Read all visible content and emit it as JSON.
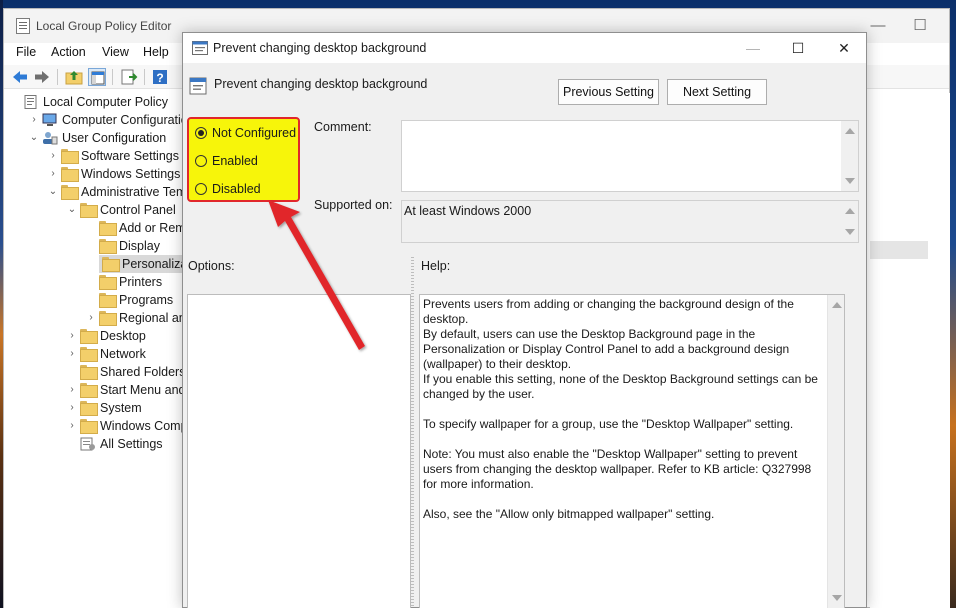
{
  "main_window": {
    "title": "Local Group Policy Editor",
    "menu": [
      "File",
      "Action",
      "View",
      "Help"
    ],
    "tree": [
      {
        "label": "Local Computer Policy",
        "depth": 0,
        "icon": "computer-policy-icon",
        "expander": ""
      },
      {
        "label": "Computer Configuration",
        "depth": 1,
        "icon": "computer-icon",
        "expander": "›"
      },
      {
        "label": "User Configuration",
        "depth": 1,
        "icon": "user-icon",
        "expander": "⌄"
      },
      {
        "label": "Software Settings",
        "depth": 2,
        "icon": "folder-icon",
        "expander": "›"
      },
      {
        "label": "Windows Settings",
        "depth": 2,
        "icon": "folder-icon",
        "expander": "›"
      },
      {
        "label": "Administrative Templ",
        "depth": 2,
        "icon": "folder-icon",
        "expander": "⌄"
      },
      {
        "label": "Control Panel",
        "depth": 3,
        "icon": "folder-open-icon",
        "expander": "⌄"
      },
      {
        "label": "Add or Remov",
        "depth": 4,
        "icon": "folder-icon",
        "expander": ""
      },
      {
        "label": "Display",
        "depth": 4,
        "icon": "folder-icon",
        "expander": ""
      },
      {
        "label": "Personalization",
        "depth": 4,
        "icon": "folder-icon",
        "expander": "",
        "selected": true
      },
      {
        "label": "Printers",
        "depth": 4,
        "icon": "folder-icon",
        "expander": ""
      },
      {
        "label": "Programs",
        "depth": 4,
        "icon": "folder-icon",
        "expander": ""
      },
      {
        "label": "Regional and L",
        "depth": 4,
        "icon": "folder-icon",
        "expander": "›"
      },
      {
        "label": "Desktop",
        "depth": 3,
        "icon": "folder-icon",
        "expander": "›"
      },
      {
        "label": "Network",
        "depth": 3,
        "icon": "folder-icon",
        "expander": "›"
      },
      {
        "label": "Shared Folders",
        "depth": 3,
        "icon": "folder-icon",
        "expander": ""
      },
      {
        "label": "Start Menu and Ta",
        "depth": 3,
        "icon": "folder-icon",
        "expander": "›"
      },
      {
        "label": "System",
        "depth": 3,
        "icon": "folder-icon",
        "expander": "›"
      },
      {
        "label": "Windows Compor",
        "depth": 3,
        "icon": "folder-icon",
        "expander": "›"
      },
      {
        "label": "All Settings",
        "depth": 3,
        "icon": "all-settings-icon",
        "expander": ""
      }
    ]
  },
  "dialog": {
    "title": "Prevent changing desktop background",
    "heading": "Prevent changing desktop background",
    "previous_label": "Previous Setting",
    "next_label": "Next Setting",
    "radios": [
      {
        "label": "Not Configured",
        "checked": true
      },
      {
        "label": "Enabled",
        "checked": false
      },
      {
        "label": "Disabled",
        "checked": false
      }
    ],
    "comment_label": "Comment:",
    "comment_value": "",
    "supported_label": "Supported on:",
    "supported_value": "At least Windows 2000",
    "options_label": "Options:",
    "help_label": "Help:",
    "help_paragraphs": [
      "Prevents users from adding or changing the background design of the desktop.",
      "By default, users can use the Desktop Background page in the Personalization or Display Control Panel to add a background design (wallpaper) to their desktop.",
      "If you enable this setting, none of the Desktop Background settings can be changed by the user.",
      "To specify wallpaper for a group, use the \"Desktop Wallpaper\" setting.",
      "Note: You must also enable the \"Desktop Wallpaper\" setting to prevent users from changing the desktop wallpaper. Refer to KB article: Q327998 for more information.",
      "Also, see the \"Allow only bitmapped wallpaper\" setting."
    ]
  },
  "colors": {
    "highlight": "#f7f50a",
    "annotation": "#e1272b"
  }
}
